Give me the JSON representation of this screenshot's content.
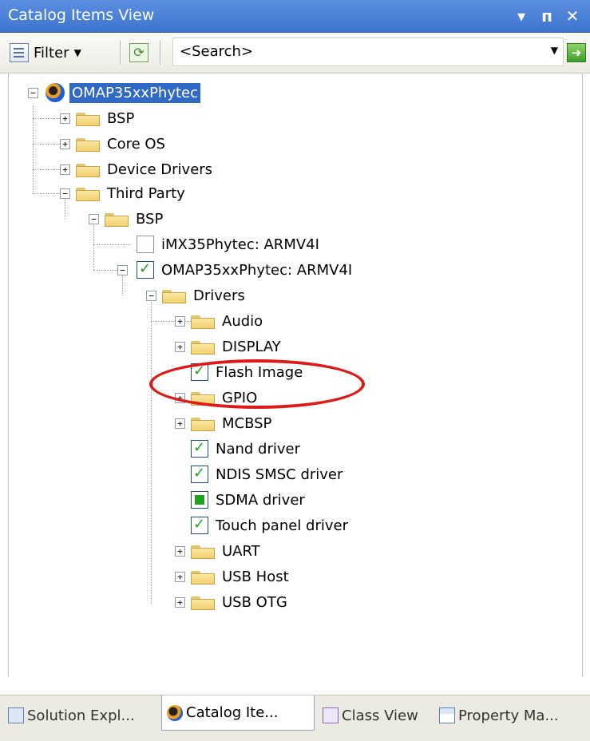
{
  "window": {
    "title": "Catalog Items View",
    "buttons": {
      "dropdown": "▾",
      "pin": "ᴨ",
      "close": "✕"
    }
  },
  "toolbar": {
    "filter_label": "Filter",
    "search_placeholder": "<Search>"
  },
  "tree": {
    "root": "OMAP35xxPhytec",
    "level1": [
      "BSP",
      "Core OS",
      "Device Drivers",
      "Third Party"
    ],
    "third_party_bsp": "BSP",
    "bsp_items": [
      "iMX35Phytec: ARMV4I",
      "OMAP35xxPhytec: ARMV4I"
    ],
    "drivers_folder": "Drivers",
    "drivers": [
      {
        "label": "Audio",
        "kind": "folder"
      },
      {
        "label": "DISPLAY",
        "kind": "folder"
      },
      {
        "label": "Flash Image",
        "kind": "check",
        "state": "on"
      },
      {
        "label": "GPIO",
        "kind": "folder"
      },
      {
        "label": "MCBSP",
        "kind": "folder"
      },
      {
        "label": "Nand driver",
        "kind": "check",
        "state": "on"
      },
      {
        "label": "NDIS SMSC driver",
        "kind": "check",
        "state": "on"
      },
      {
        "label": "SDMA driver",
        "kind": "check",
        "state": "partial"
      },
      {
        "label": "Touch panel driver",
        "kind": "check",
        "state": "on"
      },
      {
        "label": "UART",
        "kind": "folder"
      },
      {
        "label": "USB Host",
        "kind": "folder"
      },
      {
        "label": "USB OTG",
        "kind": "folder"
      }
    ]
  },
  "tabs": [
    "Solution Expl...",
    "Catalog Ite...",
    "Class View",
    "Property Ma..."
  ],
  "colors": {
    "highlight_oval": "#e01818",
    "selection": "#3169c6",
    "titlebar": "#4a80d8"
  }
}
